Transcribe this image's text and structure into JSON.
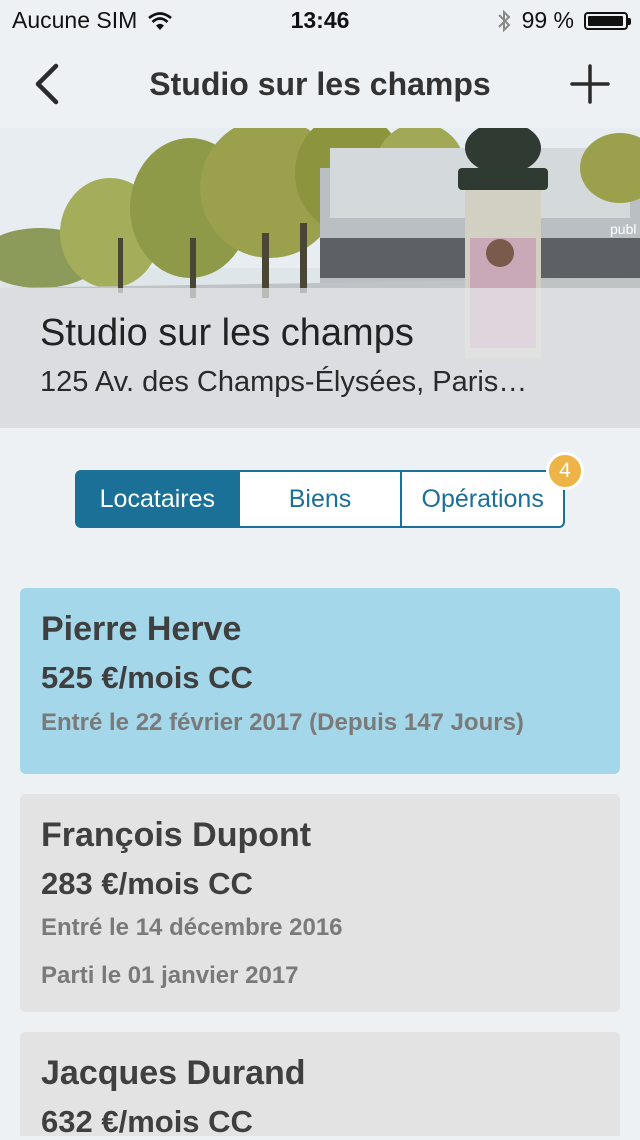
{
  "status_bar": {
    "carrier": "Aucune SIM",
    "time": "13:46",
    "battery": "99 %",
    "battery_level": 0.99
  },
  "nav": {
    "title": "Studio sur les champs"
  },
  "hero": {
    "title": "Studio sur les champs",
    "address": "125 Av. des Champs-Élysées, Paris…",
    "sign_text": "publ"
  },
  "tabs": [
    {
      "label": "Locataires",
      "active": true
    },
    {
      "label": "Biens",
      "active": false
    },
    {
      "label": "Opérations",
      "active": false,
      "badge": "4"
    }
  ],
  "tenants": [
    {
      "name": "Pierre Herve",
      "rent": "525 €/mois CC",
      "entered": "Entré le 22 février 2017 (Depuis  147 Jours)",
      "left": "",
      "active": true
    },
    {
      "name": "François Dupont",
      "rent": "283 €/mois CC",
      "entered": "Entré le 14 décembre 2016",
      "left": "Parti le 01 janvier 2017",
      "active": false
    },
    {
      "name": "Jacques Durand",
      "rent": "632 €/mois CC",
      "entered": "",
      "left": "",
      "active": false
    }
  ],
  "colors": {
    "accent": "#1a7096",
    "active_card": "#a4d7e9",
    "inactive_card": "#e3e3e3",
    "badge": "#efb447"
  }
}
